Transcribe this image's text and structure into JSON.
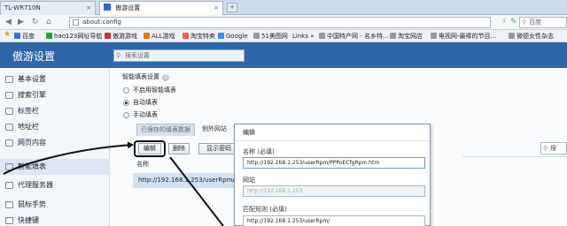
{
  "browser": {
    "tabs": [
      {
        "label": "TL-WR710N"
      },
      {
        "label": "傲游设置"
      }
    ],
    "new_tab_label": "+",
    "url": "about:config",
    "search_placeholder": "百度",
    "bookmarks": [
      {
        "label": "百度",
        "color": "#3b6fd0"
      },
      {
        "label": "hao123网址导航",
        "color": "#2a9e3c"
      },
      {
        "label": "傲游游戏",
        "color": "#c33"
      },
      {
        "label": "ALL游戏",
        "color": "#e07a10"
      },
      {
        "label": "淘宝特卖",
        "color": "#f55"
      },
      {
        "label": "Google",
        "color": "#4285f4"
      },
      {
        "label": "51美图网",
        "color": "#888"
      },
      {
        "label": "Links",
        "color": "#888"
      },
      {
        "label": "中国特产网 - 名乡特...",
        "color": "#888"
      },
      {
        "label": "淘宝网店",
        "color": "#888"
      },
      {
        "label": "电视网-最棒的节目...",
        "color": "#888"
      },
      {
        "label": "微德女性杂志",
        "color": "#888"
      }
    ]
  },
  "header": {
    "title": "傲游设置",
    "search_placeholder": "搜索设置"
  },
  "sidebar": {
    "items": [
      {
        "label": "基本设置"
      },
      {
        "label": "搜索引擎"
      },
      {
        "label": "标签栏"
      },
      {
        "label": "地址栏"
      },
      {
        "label": "网页内容"
      },
      {
        "label": "智能填表"
      },
      {
        "label": "代理服务器"
      },
      {
        "label": "鼠标手势"
      },
      {
        "label": "快捷键"
      }
    ]
  },
  "autofill": {
    "title": "智能填表设置",
    "help": "?",
    "options": [
      {
        "label": "不启用智能填表",
        "selected": false
      },
      {
        "label": "自动填表",
        "selected": true
      },
      {
        "label": "手动填表",
        "selected": false
      }
    ],
    "tabs": [
      {
        "label": "已保存的填表数据"
      },
      {
        "label": "例外网站"
      }
    ],
    "buttons": {
      "edit": "编辑",
      "delete": "删除",
      "show_password": "显示密码"
    },
    "table_header": "名称",
    "rows": [
      {
        "value": "http://192.168.1.253/userRpm/"
      }
    ],
    "search_label": "搜"
  },
  "dialog": {
    "title": "编辑",
    "name_label": "名称 (必填)",
    "name_value": "http://192.168.1.253/userRpm/PPPoECfgRpm.htm",
    "site_label": "网站",
    "site_value": "http://192.168.1.253",
    "match_label": "匹配规则 (必填)",
    "match_value": "http://192.168.1.253/userRpm/"
  },
  "colors": {
    "header_blue": "#2f66a8",
    "selected_row": "#d2e2f4"
  }
}
